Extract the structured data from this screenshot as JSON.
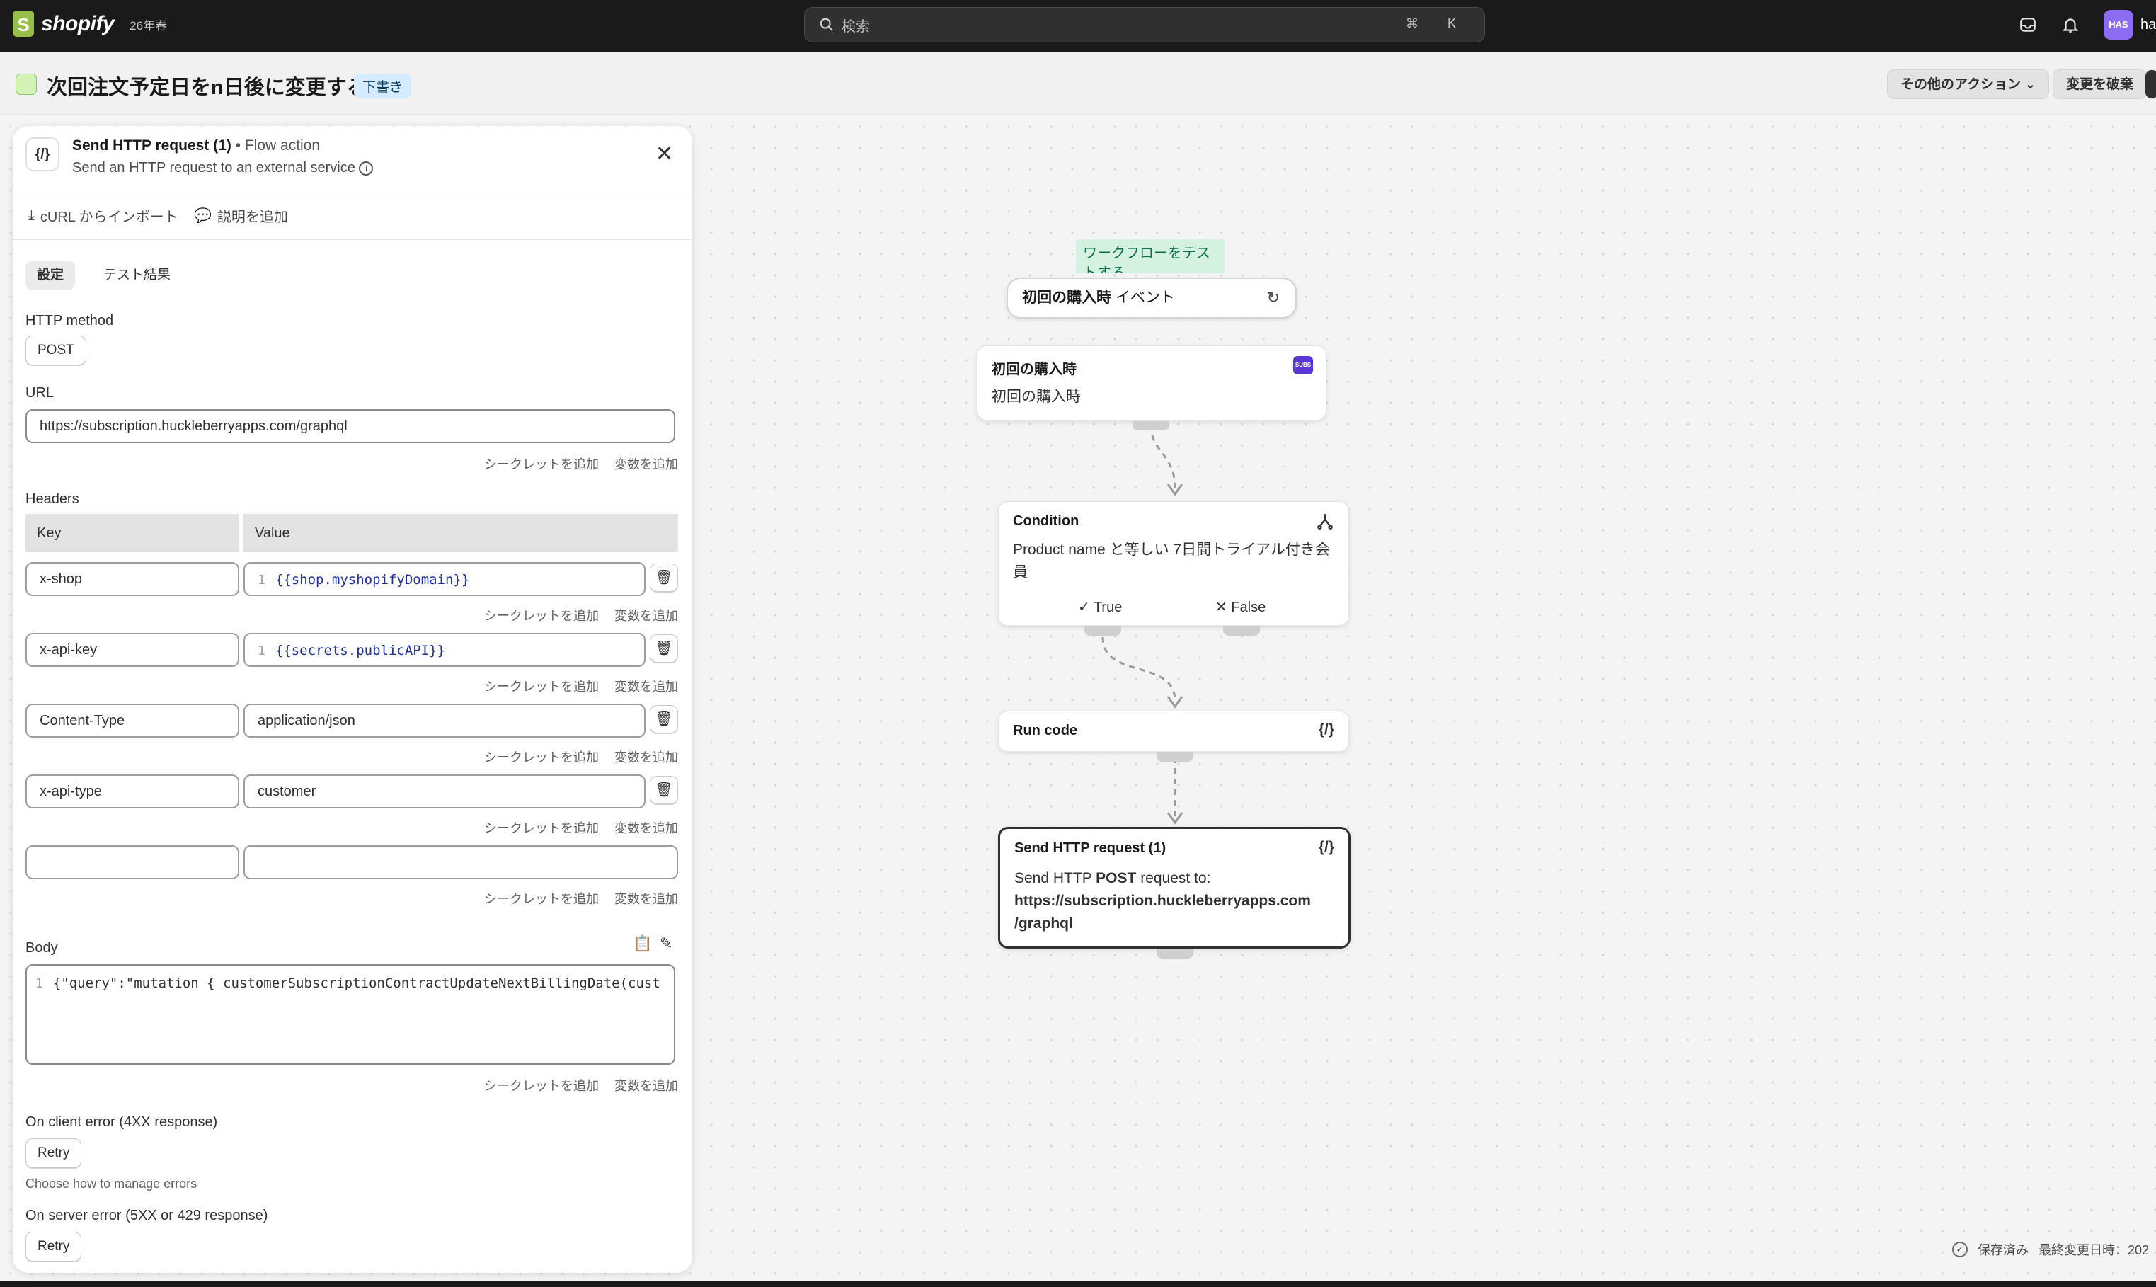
{
  "topbar": {
    "brand": "shopify",
    "version": "26年春",
    "search_placeholder": "検索",
    "search_shortcut": "⌘ K",
    "avatar_initials": "HAS",
    "user_name": "ha"
  },
  "header": {
    "title": "次回注文予定日をn日後に変更する",
    "status_badge": "下書き",
    "more_actions": "その他のアクション",
    "discard": "変更を破棄"
  },
  "panel": {
    "title": "Send HTTP request (1)",
    "type": "• Flow action",
    "description": "Send an HTTP request to an external service",
    "import_curl": "cURL からインポート",
    "add_description": "説明を追加",
    "tabs": [
      "設定",
      "テスト結果"
    ],
    "http_method_label": "HTTP method",
    "http_method": "POST",
    "url_label": "URL",
    "url": "https://subscription.huckleberryapps.com/graphql",
    "add_secret": "シークレットを追加",
    "add_variable": "変数を追加",
    "headers_label": "Headers",
    "headers_columns": [
      "Key",
      "Value"
    ],
    "headers": [
      {
        "key": "x-shop",
        "line": "1",
        "value": "{{shop.myshopifyDomain}}"
      },
      {
        "key": "x-api-key",
        "line": "1",
        "value": "{{secrets.publicAPI}}"
      },
      {
        "key": "Content-Type",
        "value": "application/json"
      },
      {
        "key": "x-api-type",
        "value": "customer"
      },
      {
        "key": "",
        "value": ""
      }
    ],
    "body_label": "Body",
    "body_line": "1",
    "body": "{\"query\":\"mutation { customerSubscriptionContractUpdateNextBillingDate(cust",
    "client_error_label": "On client error (4XX response)",
    "client_error_value": "Retry",
    "client_error_help": "Choose how to manage errors",
    "server_error_label": "On server error (5XX or 429 response)",
    "server_error_value": "Retry"
  },
  "canvas": {
    "test_note": "ワークフローをテストする",
    "trigger_event_bold": "初回の購入時",
    "trigger_event_suffix": " イベント",
    "trigger": {
      "title": "初回の購入時",
      "body": "初回の購入時",
      "badge": "SUBS"
    },
    "condition": {
      "title": "Condition",
      "body": "Product name と等しい 7日間トライアル付き会員",
      "true_label": "True",
      "false_label": "False"
    },
    "run_code": {
      "title": "Run code"
    },
    "http_node": {
      "title": "Send HTTP request (1)",
      "line1_prefix": "Send HTTP ",
      "line1_bold": "POST",
      "line1_suffix": " request to:",
      "url_line1": "https://subscription.huckleberryapps.com",
      "url_line2": "/graphql"
    }
  },
  "status": {
    "saved": "保存済み",
    "last_modified": "最終変更日時：202"
  }
}
